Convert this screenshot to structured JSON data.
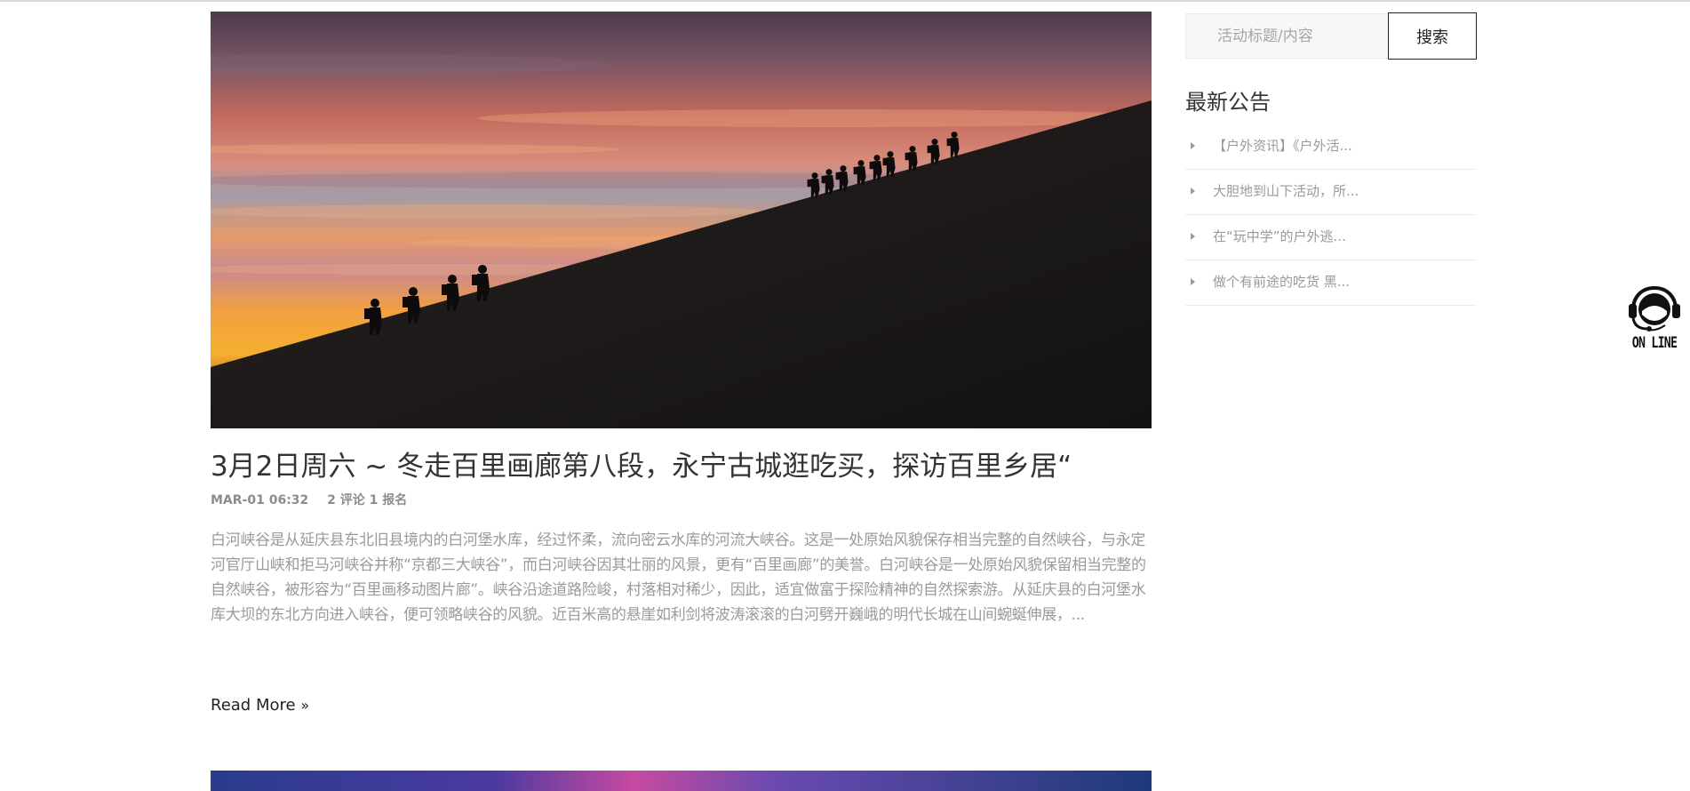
{
  "post": {
    "image_alt": "Climbers silhouetted on a snowy slope at sunset",
    "title": "3月2日周六 ~ 冬走百里画廊第八段，永宁古城逛吃买，探访百里乡居“",
    "date": "MAR-01 06:32",
    "stats": "2 评论 1 报名",
    "excerpt": "白河峡谷是从延庆县东北旧县境内的白河堡水库，经过怀柔，流向密云水库的河流大峡谷。这是一处原始风貌保存相当完整的自然峡谷，与永定河官厅山峡和拒马河峡谷并称“京都三大峡谷”，而白河峡谷因其壮丽的风景，更有“百里画廊”的美誉。白河峡谷是一处原始风貌保留相当完整的自然峡谷，被形容为“百里画移动图片廊”。峡谷沿途道路险峻，村落相对稀少，因此，适宜做富于探险精神的自然探索游。从延庆县的白河堡水库大坝的东北方向进入峡谷，便可领略峡谷的风貌。近百米高的悬崖如利剑将波涛滚滚的白河劈开巍峨的明代长城在山间蜿蜒伸展，...",
    "read_more": "Read More",
    "read_more_icon": "double-chevron-right-icon"
  },
  "sidebar": {
    "search_placeholder": "活动标题/内容",
    "search_value": "",
    "search_button": "搜索",
    "notices_title": "最新公告",
    "notices": [
      {
        "label": "【户外资讯】《户外活..."
      },
      {
        "label": "大胆地到山下活动，所..."
      },
      {
        "label": "在“玩中学”的户外逃..."
      },
      {
        "label": "做个有前途的吃货 黑..."
      }
    ]
  },
  "online_widget": {
    "label": "ON LINE",
    "icon": "customer-service-headset-icon"
  },
  "colors": {
    "text_dark": "#333333",
    "text_muted": "#9a9a9a",
    "border": "#222222"
  }
}
